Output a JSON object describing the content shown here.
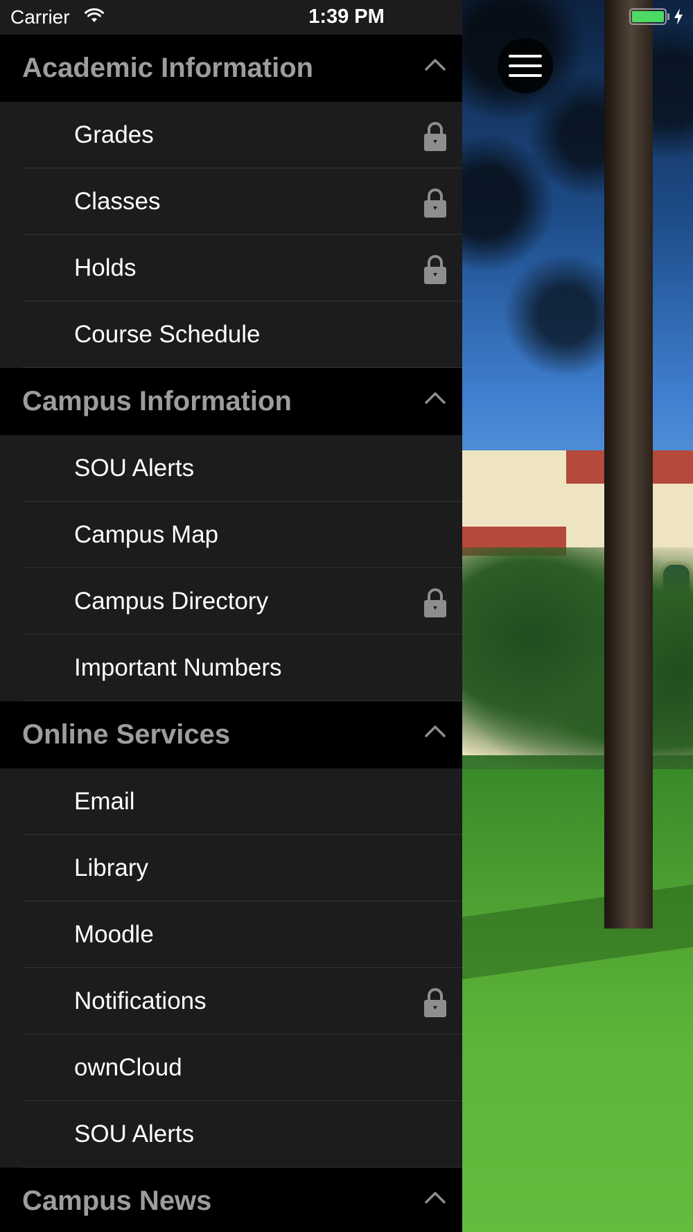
{
  "status_bar": {
    "carrier": "Carrier",
    "time": "1:39 PM",
    "battery_color": "#4cd964"
  },
  "menu": {
    "sections": [
      {
        "title": "Academic Information",
        "expanded": true,
        "items": [
          {
            "label": "Grades",
            "locked": true
          },
          {
            "label": "Classes",
            "locked": true
          },
          {
            "label": "Holds",
            "locked": true
          },
          {
            "label": "Course Schedule",
            "locked": false
          }
        ]
      },
      {
        "title": "Campus Information",
        "expanded": true,
        "items": [
          {
            "label": "SOU Alerts",
            "locked": false
          },
          {
            "label": "Campus Map",
            "locked": false
          },
          {
            "label": "Campus Directory",
            "locked": true
          },
          {
            "label": "Important Numbers",
            "locked": false
          }
        ]
      },
      {
        "title": "Online Services",
        "expanded": true,
        "items": [
          {
            "label": "Email",
            "locked": false
          },
          {
            "label": "Library",
            "locked": false
          },
          {
            "label": "Moodle",
            "locked": false
          },
          {
            "label": "Notifications",
            "locked": true
          },
          {
            "label": "ownCloud",
            "locked": false
          },
          {
            "label": "SOU Alerts",
            "locked": false
          }
        ]
      },
      {
        "title": "Campus News",
        "expanded": true,
        "items": []
      }
    ]
  },
  "colors": {
    "menu_background": "#1c1c1e",
    "section_header_background": "#000000",
    "section_title_color": "#9d9d9d",
    "item_label_color": "#ffffff",
    "lock_icon_color": "#8e8e8e"
  },
  "icons": {
    "menu_toggle": "hamburger-menu-icon",
    "section_toggle": "chevron-up-icon",
    "lock": "lock-icon"
  }
}
